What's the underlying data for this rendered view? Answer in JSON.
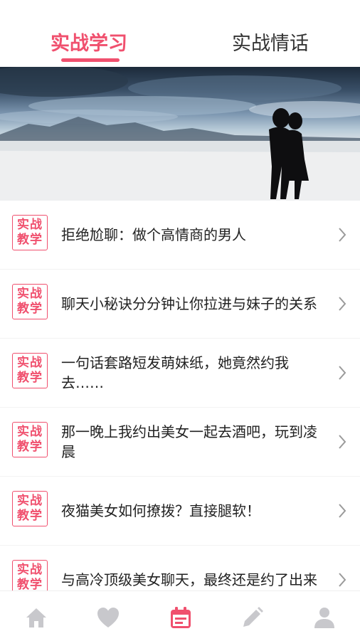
{
  "tabs": {
    "active_label": "实战学习",
    "inactive_label": "实战情话",
    "accent_color": "#f0506e"
  },
  "banner": {
    "icon": "banner-image-couple-silhouette"
  },
  "badge": {
    "line1": "实战",
    "line2": "教学"
  },
  "items": [
    {
      "title": "拒绝尬聊：做个高情商的男人"
    },
    {
      "title": "聊天小秘诀分分钟让你拉进与妹子的关系"
    },
    {
      "title": "一句话套路短发萌妹纸，她竟然约我去……"
    },
    {
      "title": "那一晚上我约出美女一起去酒吧，玩到凌晨"
    },
    {
      "title": "夜猫美女如何撩拨？直接腿软！"
    },
    {
      "title": "与高冷顶级美女聊天，最终还是约了出来"
    }
  ],
  "nav": {
    "items": [
      {
        "icon": "home-icon",
        "active": false
      },
      {
        "icon": "heart-icon",
        "active": false
      },
      {
        "icon": "calendar-icon",
        "active": true
      },
      {
        "icon": "pencil-icon",
        "active": false
      },
      {
        "icon": "user-icon",
        "active": false
      }
    ],
    "active_color": "#f0506e",
    "inactive_color": "#c8c8cc"
  }
}
